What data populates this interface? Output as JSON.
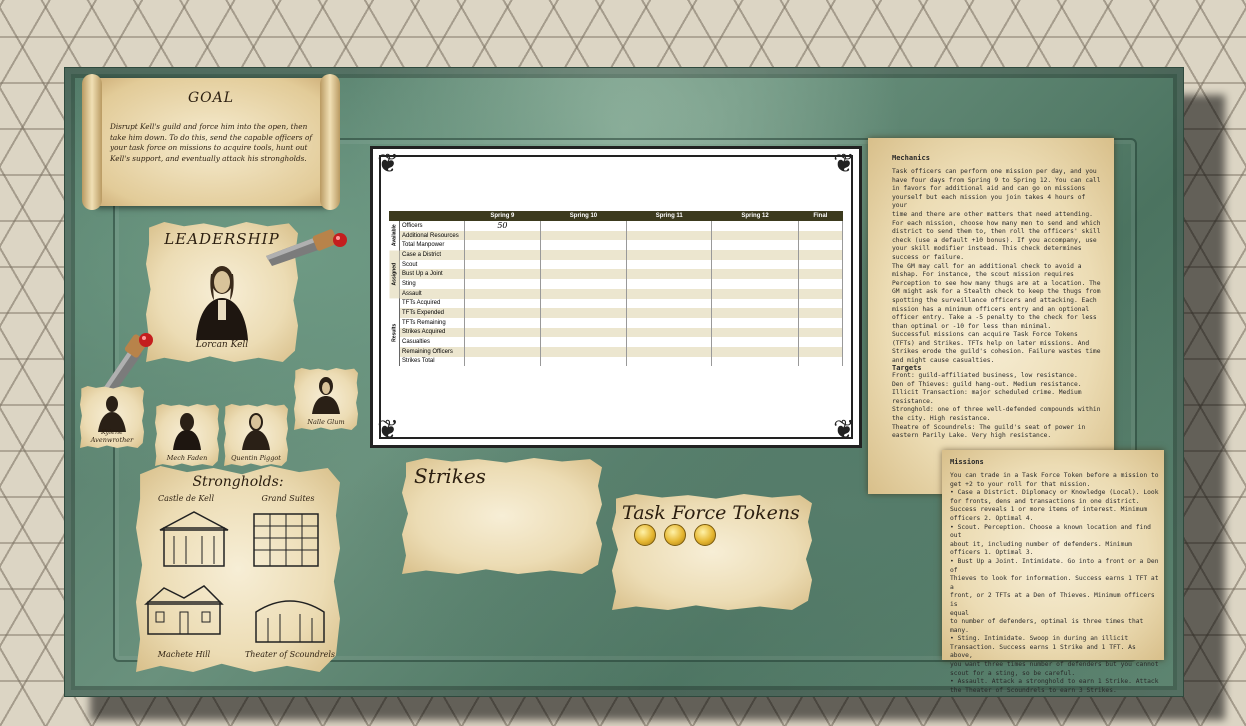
{
  "goal": {
    "title": "GOAL",
    "text": "Disrupt Kell's guild and force him into the open, then take him down. To do this, send the capable officers of your task force on missions to acquire tools, hunt out Kell's support, and eventually attack his strongholds."
  },
  "leadership": {
    "title": "LEADERSHIP",
    "leader_name": "Lorcan Kell",
    "lieutenants": [
      "Kylene Avenwrother",
      "Mech Faden",
      "Quentin Piggot",
      "Nalle Glum"
    ]
  },
  "tracker": {
    "columns": [
      "",
      "",
      "Spring 9",
      "Spring 10",
      "Spring 11",
      "Spring 12",
      "Final"
    ],
    "sections": [
      {
        "name": "Available",
        "rows": [
          "Officers",
          "Additional Resources",
          "Total Manpower"
        ]
      },
      {
        "name": "Assigned",
        "rows": [
          "Case a District",
          "Scout",
          "Bust Up a Joint",
          "Sting",
          "Assault"
        ]
      },
      {
        "name": "Results",
        "rows": [
          "TFTs Acquired",
          "TFTs Expended",
          "TFTs Remaining",
          "Strikes Acquired",
          "Casualties",
          "Remaining Officers",
          "Strikes Total"
        ]
      }
    ],
    "officers_spring9": "50"
  },
  "strongholds": {
    "title": "Strongholds:",
    "items": [
      "Castle de Kell",
      "Grand Suites",
      "Machete Hill",
      "Theater of Scoundrels"
    ]
  },
  "strikes": {
    "title": "Strikes"
  },
  "task_force_tokens": {
    "title": "Task Force Tokens",
    "count": 3
  },
  "mechanics": {
    "title": "Mechanics",
    "text": "Task officers can perform one mission per day, and you\nhave four days from Spring 9 to Spring 12. You can call\nin favors for additional aid and can go on missions\nyourself but each mission you join takes 4 hours of your\ntime and there are other matters that need attending.\nFor each mission, choose how many men to send and which\ndistrict to send them to, then roll the officers' skill\ncheck (use a default +10 bonus). If you accompany, use\nyour skill modifier instead. This check determines\nsuccess or failure.\nThe GM may call for an additional check to avoid a\nmishap. For instance, the scout mission requires\nPerception to see how many thugs are at a location. The\nGM might ask for a Stealth check to keep the thugs from\nspotting the surveillance officers and attacking. Each\nmission has a minimum officers entry and an optional\nofficer entry. Take a -5 penalty to the check for less\nthan optimal or -10 for less than minimal.\nSuccessful missions can acquire Task Force Tokens\n(TFTs) and Strikes. TFTs help on later missions. And\nStrikes erode the guild's cohesion. Failure wastes time\nand might cause casualties.",
    "targets_title": "Targets",
    "targets": "Front: guild-affiliated business, low resistance.\nDen of Thieves: guild hang-out. Medium resistance.\nIllicit Transaction: major scheduled crime. Medium\nresistance.\nStronghold: one of three well-defended compounds within\nthe city. High resistance.\nTheatre of Scoundrels: The guild's seat of power in\neastern Parily Lake. Very high resistance."
  },
  "missions": {
    "title": "Missions",
    "text": "You can trade in a Task Force Token before a mission to\nget +2 to your roll for that mission.\n• Case a District. Diplomacy or Knowledge (Local). Look\nfor fronts, dens and transactions in one district.\nSuccess reveals 1 or more items of interest. Minimum\nofficers 2. Optimal 4.\n• Scout. Perception. Choose a known location and find out\nabout it, including number of defenders. Minimum\nofficers 1. Optimal 3.\n• Bust Up a Joint. Intimidate. Go into a front or a Den of\nThieves to look for information. Success earns 1 TFT at a\nfront, or 2 TFTs at a Den of Thieves. Minimum officers is\nequal\nto number of defenders, optimal is three times that many.\n• Sting. Intimidate. Swoop in during an illicit\nTransaction. Success earns 1 Strike and 1 TFT. As above,\nyou want three times number of defenders but you cannot\nscout for a sting, so be careful.\n• Assault. Attack a stronghold to earn 1 Strike. Attack\nthe Theater of Scoundrels to earn 3 Strikes."
  },
  "colors": {
    "felt": "#5b8370",
    "parchment": "#efe2bf",
    "table_header": "#3c3a1e",
    "row_alt": "#ece6cf"
  }
}
